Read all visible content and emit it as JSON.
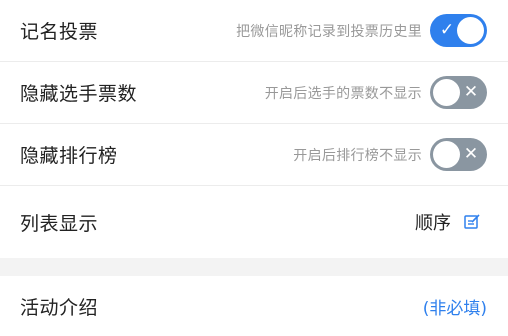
{
  "settings": {
    "named_vote": {
      "label": "记名投票",
      "hint": "把微信昵称记录到投票历史里",
      "state": "on",
      "mark": "✓"
    },
    "hide_votes": {
      "label": "隐藏选手票数",
      "hint": "开启后选手的票数不显示",
      "state": "off",
      "mark": "✕"
    },
    "hide_ranking": {
      "label": "隐藏排行榜",
      "hint": "开启后排行榜不显示",
      "state": "off",
      "mark": "✕"
    },
    "list_display": {
      "label": "列表显示",
      "value": "顺序",
      "icon": "edit-icon"
    }
  },
  "activity_intro": {
    "label": "活动介绍",
    "optional": "(非必填)"
  },
  "colors": {
    "accent": "#2f80ed",
    "toggle_off": "#8a96a1",
    "hint_text": "#999999",
    "section_gap": "#f3f3f3"
  }
}
